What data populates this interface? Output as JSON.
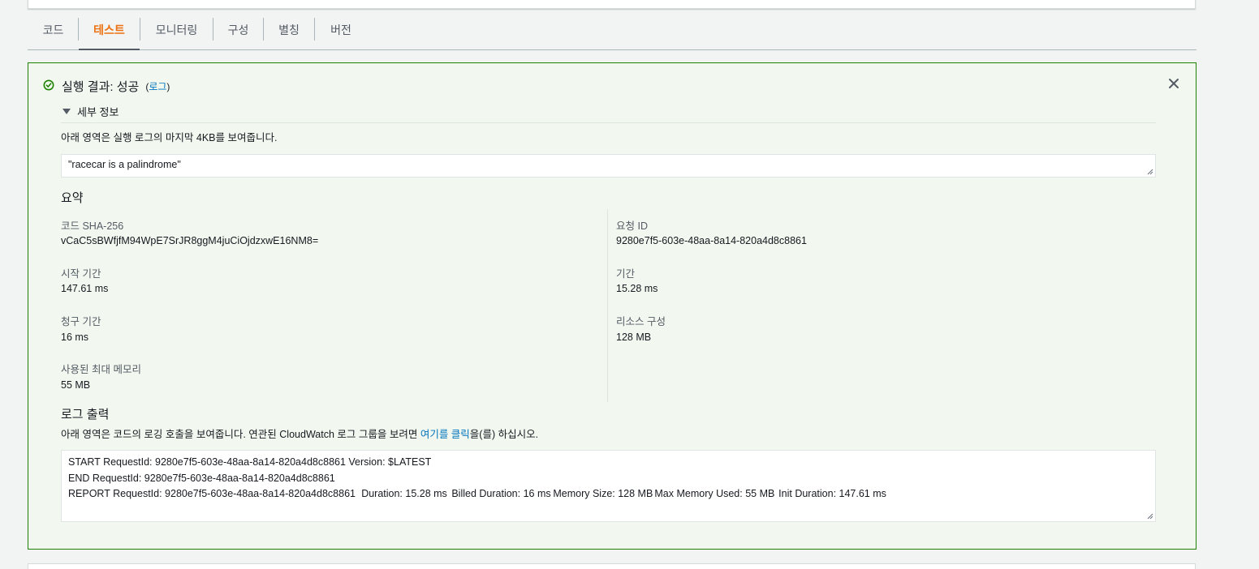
{
  "tabs": [
    {
      "label": "코드"
    },
    {
      "label": "테스트"
    },
    {
      "label": "모니터링"
    },
    {
      "label": "구성"
    },
    {
      "label": "별칭"
    },
    {
      "label": "버전"
    }
  ],
  "active_tab": "테스트",
  "result": {
    "title": "실행 결과: 성공",
    "log_link_open": "(",
    "log_link": "로그",
    "log_link_close": ")",
    "details_label": "세부 정보",
    "details_description": "아래 영역은 실행 로그의 마지막 4KB를 보여줍니다.",
    "return_value": "\"racecar is a palindrome\"",
    "summary_title": "요약",
    "summary": {
      "code_sha_label": "코드 SHA-256",
      "code_sha_value": "vCaC5sBWfjfM94WpE7SrJR8ggM4juCiOjdzxwE16NM8=",
      "request_id_label": "요청 ID",
      "request_id_value": "9280e7f5-603e-48aa-8a14-820a4d8c8861",
      "init_duration_label": "시작 기간",
      "init_duration_value": "147.61 ms",
      "duration_label": "기간",
      "duration_value": "15.28 ms",
      "billed_duration_label": "청구 기간",
      "billed_duration_value": "16 ms",
      "resources_label": "리소스 구성",
      "resources_value": "128 MB",
      "max_memory_label": "사용된 최대 메모리",
      "max_memory_value": "55 MB"
    },
    "log_output_title": "로그 출력",
    "log_desc_before": "아래 영역은 코드의 로깅 호출을 보여줍니다. 연관된 CloudWatch 로그 그룹을 보려면 ",
    "log_desc_link": "여기를 클릭",
    "log_desc_after": "을(를) 하십시오.",
    "log_lines": [
      "START RequestId: 9280e7f5-603e-48aa-8a14-820a4d8c8861 Version: $LATEST",
      "END RequestId: 9280e7f5-603e-48aa-8a14-820a4d8c8861",
      "REPORT RequestId: 9280e7f5-603e-48aa-8a14-820a4d8c8861\tDuration: 15.28 ms\tBilled Duration: 16 ms\tMemory Size: 128 MB\tMax Memory Used: 55 MB\tInit Duration: 147.61 ms"
    ]
  },
  "icons": {
    "success": "check-circle-icon",
    "close": "close-icon",
    "expand": "caret-down-icon"
  },
  "colors": {
    "accent": "#ec7211",
    "success_border": "#1d8102",
    "success_bg": "#f2f8f0",
    "link": "#0073bb"
  }
}
